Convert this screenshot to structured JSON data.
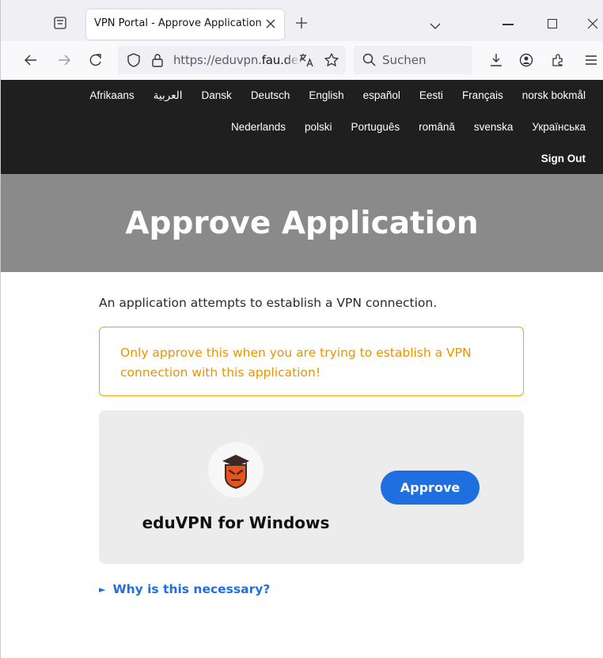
{
  "browser": {
    "tab_title": "VPN Portal - Approve Application",
    "url_prefix": "https://eduvpn.",
    "url_domain": "fau.de",
    "url_suffix": "/",
    "search_label": "Suchen"
  },
  "header": {
    "languages_row1": [
      "Afrikaans",
      "العربية",
      "Dansk",
      "Deutsch",
      "English",
      "español",
      "Eesti",
      "Français",
      "norsk bokmål"
    ],
    "languages_row2": [
      "Nederlands",
      "polski",
      "Português",
      "română",
      "svenska",
      "Українська"
    ],
    "sign_out": "Sign Out"
  },
  "banner": {
    "title": "Approve Application"
  },
  "main": {
    "intro": "An application attempts to establish a VPN connection.",
    "warning": "Only approve this when you are trying to establish a VPN connection with this application!",
    "app_name": "eduVPN for Windows",
    "approve_label": "Approve",
    "details_label": "Why is this necessary?",
    "details_marker": "►"
  },
  "colors": {
    "header_bg": "#1f1f1f",
    "banner_bg": "#8a8a8a",
    "warning": "#f0a500",
    "accent": "#1f6fe0",
    "logo_orange": "#e8521f"
  },
  "icons": [
    "tab-list-icon",
    "close-icon",
    "plus-icon",
    "chevron-down-icon",
    "minimize-icon",
    "maximize-icon",
    "back-icon",
    "forward-icon",
    "reload-icon",
    "shield-icon",
    "lock-icon",
    "translate-icon",
    "star-icon",
    "search-icon",
    "download-icon",
    "account-icon",
    "extensions-icon",
    "menu-icon",
    "eduvpn-logo-icon"
  ]
}
